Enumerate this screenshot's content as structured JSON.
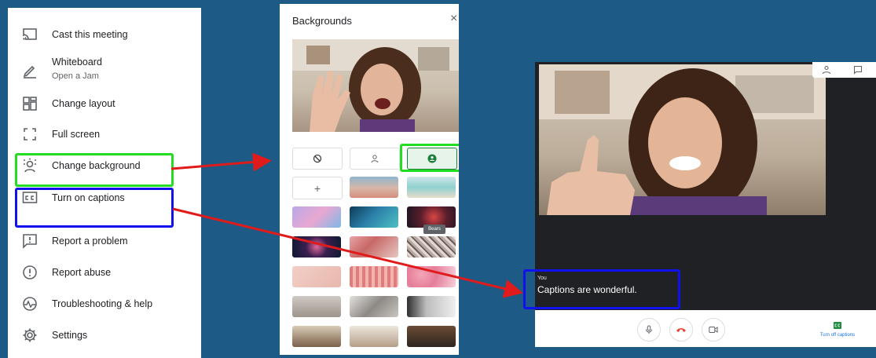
{
  "menu": {
    "items": [
      {
        "label": "Cast this meeting",
        "icon": "cast-icon"
      },
      {
        "label": "Whiteboard",
        "sublabel": "Open a Jam",
        "icon": "pen-icon"
      },
      {
        "label": "Change layout",
        "icon": "layout-icon"
      },
      {
        "label": "Full screen",
        "icon": "fullscreen-icon"
      },
      {
        "label": "Change background",
        "icon": "background-icon"
      },
      {
        "label": "Turn on captions",
        "icon": "captions-icon"
      },
      {
        "label": "Report a problem",
        "icon": "report-problem-icon"
      },
      {
        "label": "Report abuse",
        "icon": "report-abuse-icon"
      },
      {
        "label": "Troubleshooting & help",
        "icon": "troubleshooting-icon"
      },
      {
        "label": "Settings",
        "icon": "settings-icon"
      }
    ]
  },
  "backgrounds": {
    "title": "Backgrounds",
    "close": "×",
    "tooltip": "Bears"
  },
  "meet": {
    "caption_speaker": "You",
    "caption_text": "Captions are wonderful.",
    "captions_toggle_label": "Turn off captions"
  },
  "colors": {
    "page_bg": "#1d5a86",
    "highlight_green": "#22dd22",
    "highlight_blue": "#1111ee",
    "arrow_red": "#e01b1b",
    "hangup_red": "#ea4335",
    "accent_blue": "#1a73e8"
  }
}
